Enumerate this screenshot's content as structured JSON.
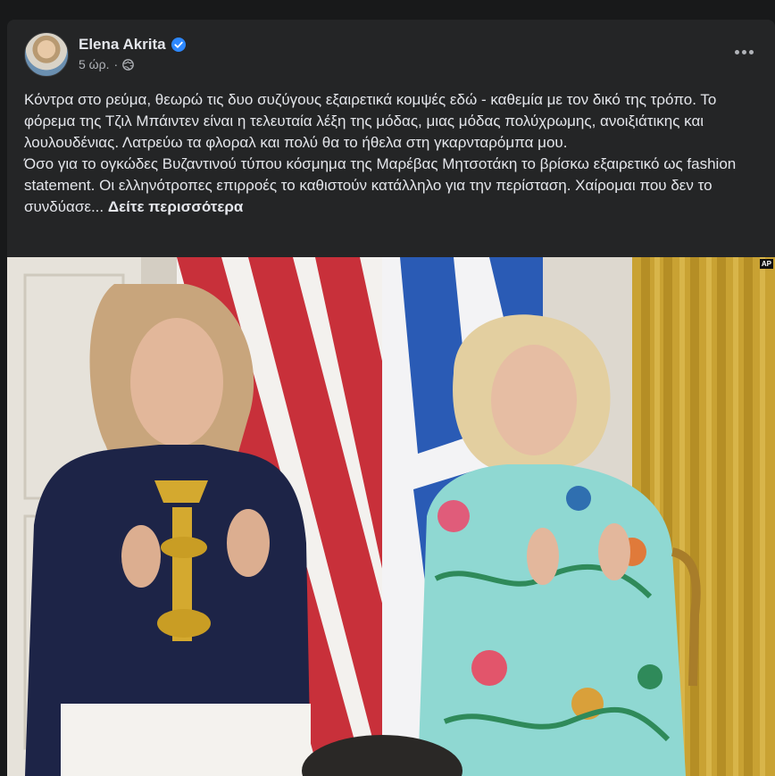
{
  "post": {
    "author": "Elena Akrita",
    "time": "5 ώρ.",
    "text_lines": [
      "Κόντρα στο ρεύμα, θεωρώ τις δυο συζύγους εξαιρετικά κομψές εδώ - καθεμία  με τον δικό της τρόπο. Το φόρεμα της Τζιλ Μπάιντεν είναι η τελευταία λέξη της μόδας, μιας μόδας πολύχρωμης, ανοιξιάτικης και λουλουδένιας. Λατρεύω τα φλοραλ και πολύ θα το ήθελα στη γκαρνταρόμπα μου.",
      "Όσο για το ογκώδες Βυζαντινού τύπου κόσμημα της Μαρέβας Μητσοτάκη το βρίσκω εξαιρετικό ως fashion statement. Οι ελληνότροπες επιρροές το καθιστούν κατάλληλο για την περίσταση. Χαίρομαι που δεν το συνδύασε..."
    ],
    "see_more": "Δείτε περισσότερα",
    "photo_badge": "AP"
  },
  "icons": {
    "verified": "verified-badge-icon",
    "audience": "globe-icon",
    "more": "more-options-icon"
  },
  "colors": {
    "background": "#18191a",
    "card": "#242526",
    "primary_text": "#e4e6eb",
    "secondary_text": "#b0b3b8",
    "verified_blue": "#2d88ff"
  }
}
